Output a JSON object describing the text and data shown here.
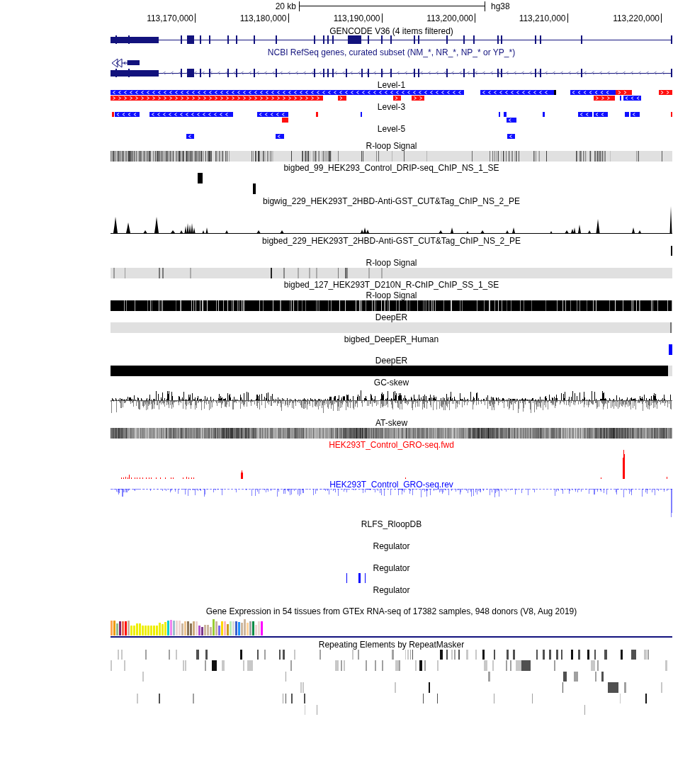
{
  "ruler": {
    "scale": "20 kb",
    "assembly": "hg38",
    "positions": [
      "113,170,000",
      "113,180,000",
      "113,190,000",
      "113,200,000",
      "113,210,000",
      "113,220,000"
    ]
  },
  "tracks": [
    {
      "title": "GENCODE V36 (4 items filtered)",
      "kind": "gencode",
      "color": "#000000"
    },
    {
      "title": "NCBI RefSeq genes, curated subset (NM_*, NR_*, NP_* or YP_*)",
      "kind": "refseq",
      "color": "#12127d"
    },
    {
      "title": "Level-1",
      "kind": "levels",
      "color": "#000000"
    },
    {
      "title": "Level-3",
      "kind": "levels",
      "color": "#000000"
    },
    {
      "title": "Level-5",
      "kind": "levels",
      "color": "#000000"
    },
    {
      "title": "R-loop Signal",
      "kind": "heatmap",
      "color": "#000000"
    },
    {
      "title": "bigbed_99_HEK293_Control_DRIP-seq_ChIP_NS_1_SE",
      "kind": "blocks",
      "color": "#000000"
    },
    {
      "title": "bigwig_229_HEK293T_2HBD-Anti-GST_CUT&Tag_ChIP_NS_2_PE",
      "kind": "wiggle",
      "color": "#000000"
    },
    {
      "title": "bigbed_229_HEK293T_2HBD-Anti-GST_CUT&Tag_ChIP_NS_2_PE",
      "kind": "blocks",
      "color": "#000000"
    },
    {
      "title": "R-loop Signal",
      "kind": "heatmap",
      "color": "#000000"
    },
    {
      "title": "bigbed_127_HEK293T_D210N_R-ChIP_ChIP_SS_1_SE",
      "kind": "empty",
      "color": "#000000"
    },
    {
      "title": "R-loop Signal",
      "kind": "heatmap",
      "color": "#000000"
    },
    {
      "title": "DeepER",
      "kind": "heatmap",
      "color": "#000000"
    },
    {
      "title": "bigbed_DeepER_Human",
      "kind": "blocks",
      "color": "#000000"
    },
    {
      "title": "DeepER",
      "kind": "heatmap",
      "color": "#000000"
    },
    {
      "title": "GC-skew",
      "kind": "skew",
      "color": "#000000"
    },
    {
      "title": "AT-skew",
      "kind": "heatmap",
      "color": "#000000"
    },
    {
      "title": "HEK293T_Control_GRO-seq.fwd",
      "kind": "plus",
      "color": "#ff0000"
    },
    {
      "title": "HEK293T_Control_GRO-seq.rev",
      "kind": "minus",
      "color": "#0000ff"
    },
    {
      "title": "RLFS_RloopDB",
      "kind": "empty",
      "color": "#000000"
    },
    {
      "title": "Regulator",
      "kind": "empty",
      "color": "#000000"
    },
    {
      "title": "Regulator",
      "kind": "blocks",
      "color": "#000000"
    },
    {
      "title": "Regulator",
      "kind": "empty",
      "color": "#000000"
    },
    {
      "title": "Gene Expression in 54 tissues from GTEx RNA-seq of 17382 samples, 948 donors (V8, Aug 2019)",
      "kind": "expression",
      "color": "#000000"
    },
    {
      "title": "Repeating Elements by RepeatMasker",
      "kind": "repeats",
      "color": "#000000"
    }
  ]
}
